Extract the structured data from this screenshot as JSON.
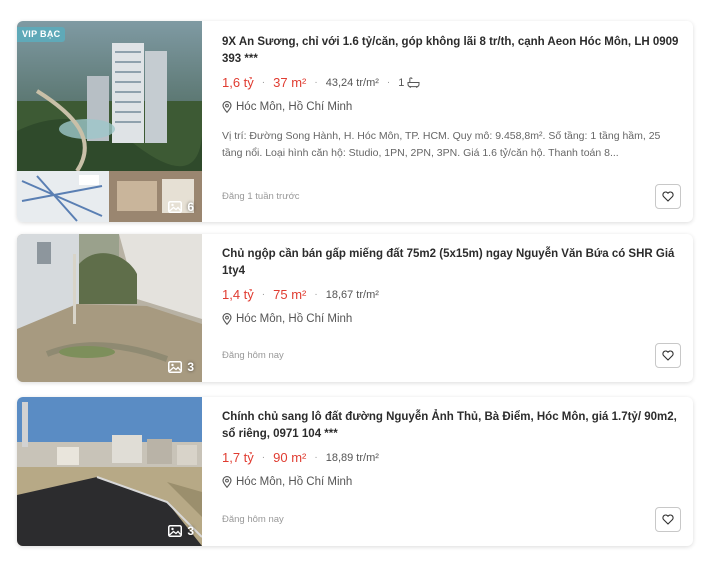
{
  "listings": [
    {
      "badge": "VIP BẠC",
      "title": "9X An Sương, chỉ với 1.6 tỷ/căn, góp không lãi 8 tr/th, cạnh Aeon Hóc Môn, LH 0909 393 ***",
      "price": "1,6 tỷ",
      "area": "37 m²",
      "price_per_m2": "43,24 tr/m²",
      "bathrooms": "1",
      "location": "Hóc Môn, Hồ Chí Minh",
      "description": "Vị trí: Đường Song Hành, H. Hóc Môn, TP. HCM. Quy mô: 9.458,8m². Số tầng: 1 tầng hầm, 25 tầng nổi. Loại hình căn hộ: Studio, 1PN, 2PN, 3PN. Giá 1.6 tỷ/căn hộ. Thanh toán 8...",
      "posted": "Đăng 1 tuần trước",
      "photo_count": "6"
    },
    {
      "title": "Chủ ngộp cần bán gấp miếng đất 75m2 (5x15m) ngay Nguyễn Văn Bứa có SHR Giá 1ty4",
      "price": "1,4 tỷ",
      "area": "75 m²",
      "price_per_m2": "18,67 tr/m²",
      "location": "Hóc Môn, Hồ Chí Minh",
      "posted": "Đăng hôm nay",
      "photo_count": "3"
    },
    {
      "title": "Chính chủ sang lô đất đường Nguyễn Ảnh Thủ, Bà Điểm, Hóc Môn, giá 1.7tỷ/ 90m2, sổ riêng, 0971 104 ***",
      "price": "1,7 tỷ",
      "area": "90 m²",
      "price_per_m2": "18,89 tr/m²",
      "location": "Hóc Môn, Hồ Chí Minh",
      "posted": "Đăng hôm nay",
      "photo_count": "3"
    }
  ],
  "icons": {
    "location": "location-pin-icon",
    "bath": "bathtub-icon",
    "gallery": "image-gallery-icon",
    "favorite": "heart-outline-icon"
  },
  "colors": {
    "price": "#e03c31",
    "badge": "#5fa9b8"
  }
}
